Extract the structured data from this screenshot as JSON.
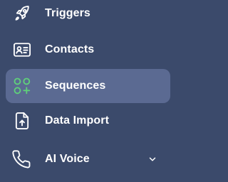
{
  "sidebar": {
    "items": [
      {
        "label": "Triggers",
        "icon": "rocket-icon",
        "active": false
      },
      {
        "label": "Contacts",
        "icon": "contact-card-icon",
        "active": false
      },
      {
        "label": "Sequences",
        "icon": "sequences-grid-plus-icon",
        "active": true
      },
      {
        "label": "Data Import",
        "icon": "file-upload-icon",
        "active": false
      },
      {
        "label": "AI Voice",
        "icon": "phone-icon",
        "active": false,
        "expandable": true
      }
    ]
  },
  "colors": {
    "background": "#3b4a6b",
    "active_background": "#5b6a92",
    "text": "#ffffff",
    "accent_green": "#5fd07a"
  }
}
